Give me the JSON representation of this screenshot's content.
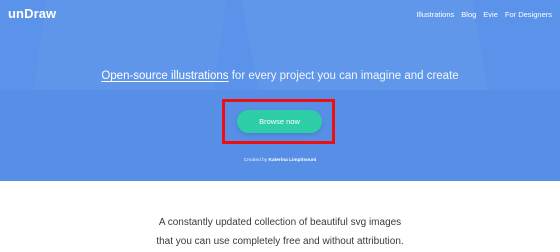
{
  "header": {
    "logo": "unDraw",
    "nav": [
      "Illustrations",
      "Blog",
      "Evie",
      "For Designers"
    ]
  },
  "hero": {
    "tagline_highlight": "Open-source illustrations",
    "tagline_rest": "for every project you can imagine and create",
    "browse_label": "Browse now",
    "credit_prefix": "Created by",
    "credit_name": "Katerina Limpitsouni"
  },
  "main": {
    "description_line1": "A constantly updated collection of beautiful svg images",
    "description_line2": "that you can use completely free and without attribution."
  },
  "colors": {
    "hero_bg": "#5b93ea",
    "button_bg": "#2dcea7",
    "highlight_border": "#ee1010"
  }
}
